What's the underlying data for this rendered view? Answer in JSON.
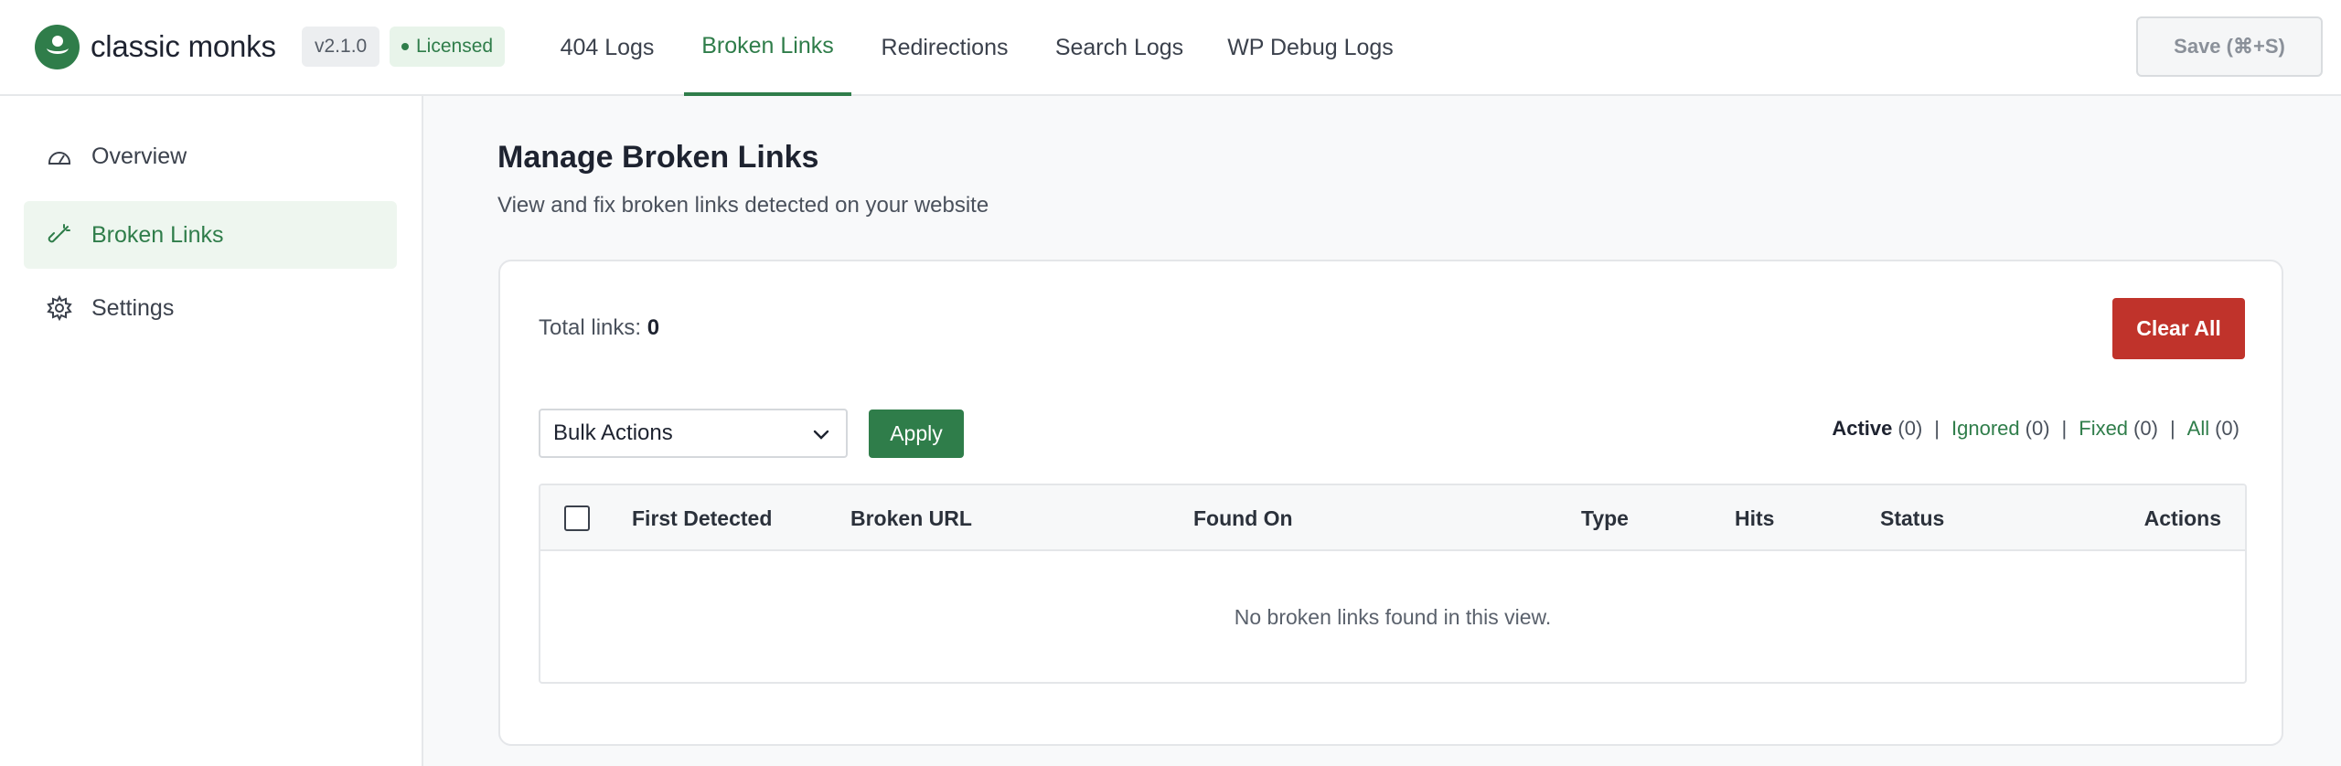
{
  "brand": {
    "name": "classic monks",
    "version": "v2.1.0",
    "license": "Licensed",
    "accent": "#2f7d4a",
    "danger": "#c0332b"
  },
  "nav": {
    "tabs": [
      {
        "label": "404 Logs"
      },
      {
        "label": "Broken Links",
        "active": true
      },
      {
        "label": "Redirections"
      },
      {
        "label": "Search Logs"
      },
      {
        "label": "WP Debug Logs"
      }
    ],
    "save_label": "Save (⌘+S)"
  },
  "sidebar": {
    "items": [
      {
        "label": "Overview",
        "icon": "gauge-icon"
      },
      {
        "label": "Broken Links",
        "icon": "broken-link-icon",
        "active": true
      },
      {
        "label": "Settings",
        "icon": "gear-icon"
      }
    ]
  },
  "main": {
    "title": "Manage Broken Links",
    "subtitle": "View and fix broken links detected on your website",
    "total_label": "Total links:",
    "total_value": "0",
    "clear_label": "Clear All",
    "bulk_actions": {
      "selected": "Bulk Actions"
    },
    "apply_label": "Apply",
    "filters": [
      {
        "label": "Active",
        "count": "(0)",
        "current": true
      },
      {
        "label": "Ignored",
        "count": "(0)"
      },
      {
        "label": "Fixed",
        "count": "(0)"
      },
      {
        "label": "All",
        "count": "(0)"
      }
    ],
    "table": {
      "columns": [
        "First Detected",
        "Broken URL",
        "Found On",
        "Type",
        "Hits",
        "Status",
        "Actions"
      ],
      "empty_message": "No broken links found in this view."
    }
  }
}
